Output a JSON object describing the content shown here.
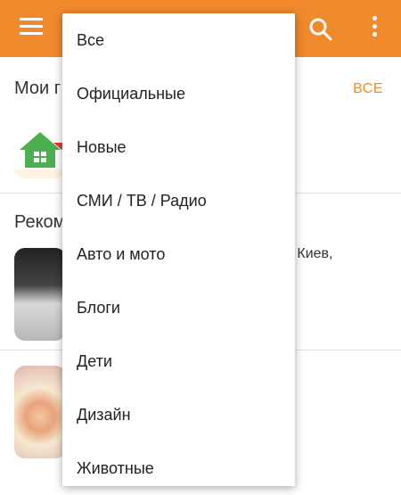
{
  "header": {
    "menu_icon": "hamburger-menu-icon",
    "search_icon": "search-icon",
    "more_icon": "more-vertical-icon",
    "accent_color": "#f0892c"
  },
  "background": {
    "my_groups_title": "Мои г",
    "all_link": "ВСЕ",
    "recommended_title": "Реком",
    "snippet_text": "в, Киев,"
  },
  "dropdown": {
    "items": [
      "Все",
      "Официальные",
      "Новые",
      "СМИ / ТВ / Радио",
      "Авто и мото",
      "Блоги",
      "Дети",
      "Дизайн",
      "Животные"
    ]
  }
}
